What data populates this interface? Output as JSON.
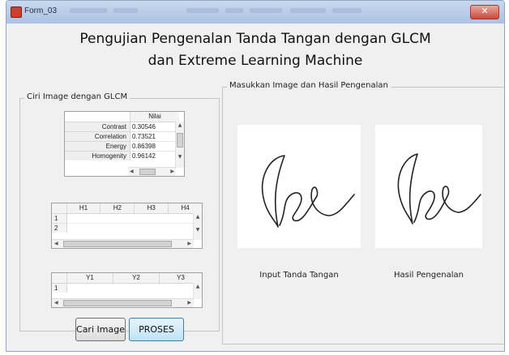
{
  "window": {
    "title": "Form_03",
    "close_glyph": "✕"
  },
  "heading": {
    "line1": "Pengujian Pengenalan Tanda Tangan dengan GLCM",
    "line2": "dan Extreme Learning Machine"
  },
  "left_group": {
    "legend": "Ciri Image dengan GLCM",
    "feature_table": {
      "column_header": "Nilai",
      "rows": [
        {
          "label": "Contrast",
          "value": "0.30546"
        },
        {
          "label": "Correlation",
          "value": "0.73521"
        },
        {
          "label": "Energy",
          "value": "0.86398"
        },
        {
          "label": "Homogenity",
          "value": "0.96142"
        }
      ]
    },
    "h_table": {
      "headers": [
        "H1",
        "H2",
        "H3",
        "H4"
      ],
      "row_numbers": [
        "1",
        "2"
      ]
    },
    "y_table": {
      "headers": [
        "Y1",
        "Y2",
        "Y3"
      ],
      "row_numbers": [
        "1"
      ]
    },
    "buttons": {
      "cari_image": "Cari Image",
      "proses": "PROSES"
    }
  },
  "right_group": {
    "legend": "Masukkan Image dan Hasil Pengenalan",
    "input_caption": "Input Tanda Tangan",
    "result_caption": "Hasil Pengenalan"
  }
}
